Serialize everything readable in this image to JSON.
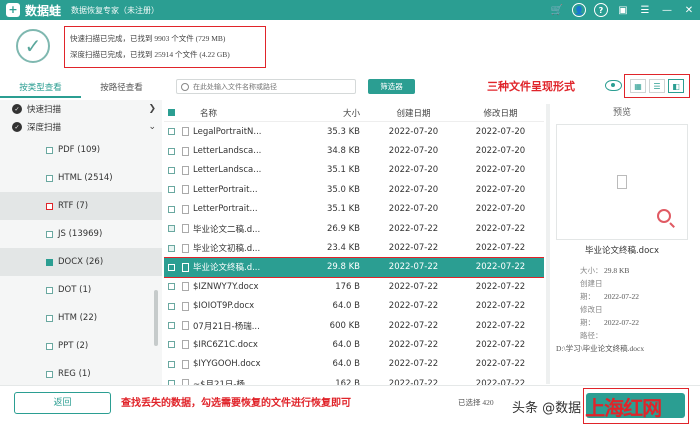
{
  "app": {
    "name": "数据蛙",
    "subtitle": "数据恢复专家（未注册）"
  },
  "scan": {
    "quick": "快速扫描已完成，已找到 9903 个文件 (729 MB)",
    "deep": "深度扫描已完成，已找到 25914 个文件 (4.22 GB)"
  },
  "left_tabs": [
    "按类型查看",
    "按路径查看"
  ],
  "tree": {
    "quick_label": "快速扫描",
    "deep_label": "深度扫描",
    "items": [
      {
        "label": "PDF (109)"
      },
      {
        "label": "HTML (2514)"
      },
      {
        "label": "RTF (7)"
      },
      {
        "label": "JS (13969)"
      },
      {
        "label": "DOCX (26)"
      },
      {
        "label": "DOT (1)"
      },
      {
        "label": "HTM (22)"
      },
      {
        "label": "PPT (2)"
      },
      {
        "label": "REG (1)"
      }
    ]
  },
  "search": {
    "placeholder": "在此处输入文件名称或路径"
  },
  "filter_label": "筛选器",
  "annotations": {
    "views": "三种文件呈现形式",
    "bottom": "查找丢失的数据，勾选需要恢复的文件进行恢复即可"
  },
  "view_icons": [
    "grid-view-icon",
    "list-view-icon",
    "preview-view-icon"
  ],
  "table": {
    "headers": {
      "name": "名称",
      "size": "大小",
      "created": "创建日期",
      "modified": "修改日期"
    },
    "rows": [
      {
        "name": "LegalPortraitN...",
        "size": "35.3 KB",
        "created": "2022-07-20",
        "modified": "2022-07-20"
      },
      {
        "name": "LetterLandsca...",
        "size": "34.8 KB",
        "created": "2022-07-20",
        "modified": "2022-07-20"
      },
      {
        "name": "LetterLandsca...",
        "size": "35.1 KB",
        "created": "2022-07-20",
        "modified": "2022-07-20"
      },
      {
        "name": "LetterPortrait...",
        "size": "35.0 KB",
        "created": "2022-07-20",
        "modified": "2022-07-20"
      },
      {
        "name": "LetterPortrait...",
        "size": "35.1 KB",
        "created": "2022-07-20",
        "modified": "2022-07-20"
      },
      {
        "name": "毕业论文二稿.d...",
        "size": "26.9 KB",
        "created": "2022-07-22",
        "modified": "2022-07-22"
      },
      {
        "name": "毕业论文初稿.d...",
        "size": "23.4 KB",
        "created": "2022-07-22",
        "modified": "2022-07-22"
      },
      {
        "name": "毕业论文终稿.d...",
        "size": "29.8 KB",
        "created": "2022-07-22",
        "modified": "2022-07-22"
      },
      {
        "name": "$IZNWY7Y.docx",
        "size": "176 B",
        "created": "2022-07-22",
        "modified": "2022-07-22"
      },
      {
        "name": "$IOIOT9P.docx",
        "size": "64.0 B",
        "created": "2022-07-22",
        "modified": "2022-07-22"
      },
      {
        "name": "07月21日-杨瑞...",
        "size": "600 KB",
        "created": "2022-07-22",
        "modified": "2022-07-22"
      },
      {
        "name": "$IRC6Z1C.docx",
        "size": "64.0 B",
        "created": "2022-07-22",
        "modified": "2022-07-22"
      },
      {
        "name": "$IYYGOOH.docx",
        "size": "64.0 B",
        "created": "2022-07-22",
        "modified": "2022-07-22"
      },
      {
        "name": "~$月21日-杨...",
        "size": "162 B",
        "created": "2022-07-22",
        "modified": "2022-07-22"
      }
    ]
  },
  "preview": {
    "title": "预览",
    "file_name": "毕业论文终稿.docx",
    "meta": [
      {
        "label": "大小：",
        "value": "29.8 KB"
      },
      {
        "label": "创建日期：",
        "value": "2022-07-22"
      },
      {
        "label": "修改日期：",
        "value": "2022-07-22"
      },
      {
        "label": "路径：",
        "value": ""
      }
    ],
    "path": "D:\\学习\\毕业论文终稿.docx"
  },
  "bottom": {
    "back": "返回",
    "selected": "已选择 420"
  },
  "watermark": {
    "text": "头条 @数据",
    "logo": "上海红网"
  }
}
